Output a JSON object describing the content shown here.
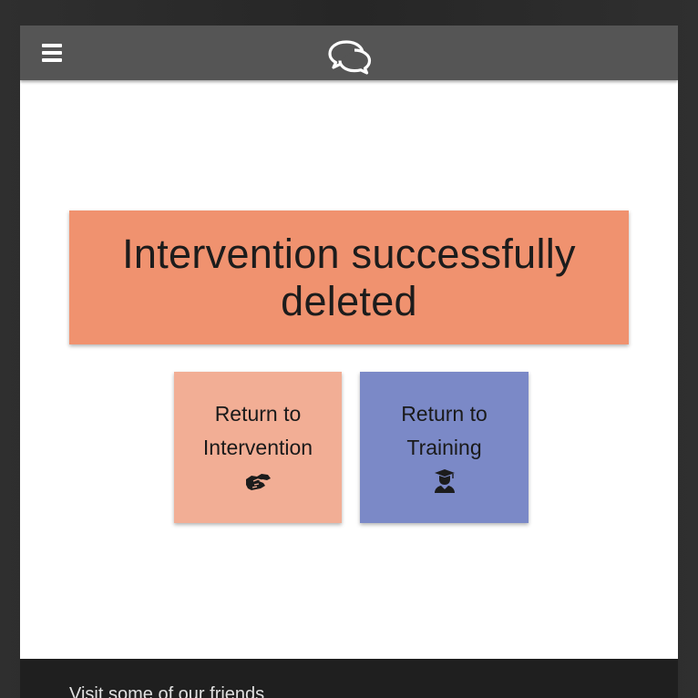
{
  "header": {
    "menu_icon": "hamburger-menu-icon",
    "logo_icon": "chat-bubbles-icon",
    "background": "#555555"
  },
  "message": {
    "text": "Intervention successfully deleted",
    "background": "#f0926f"
  },
  "actions": [
    {
      "label": "Return to Intervention",
      "icon": "handshake-icon",
      "background": "#f2ae95"
    },
    {
      "label": "Return to Training",
      "icon": "graduate-icon",
      "background": "#7b89c7"
    }
  ],
  "footer": {
    "text": "Visit some of our friends"
  }
}
